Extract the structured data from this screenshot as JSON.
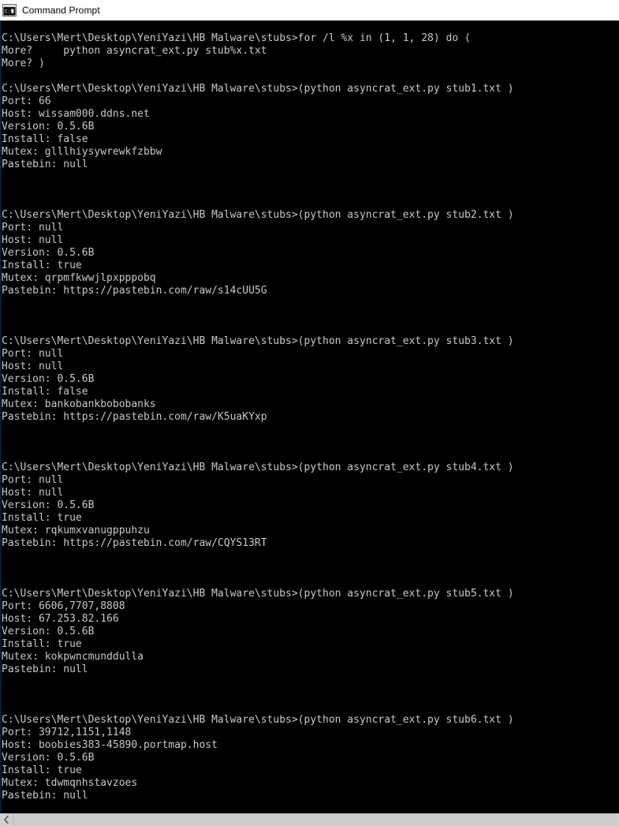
{
  "window": {
    "title": "Command Prompt",
    "icon": "console-icon",
    "colors": {
      "titlebar_bg": "#ffffff",
      "titlebar_text": "#000000",
      "console_bg": "#000000",
      "console_text": "#c8c8c8",
      "scrollbar_bg": "#d0d0d0"
    }
  },
  "scrollbar": {
    "left_arrow_icon": "chevron-left-icon",
    "orientation": "horizontal"
  },
  "console": {
    "prompt_path": "C:\\Users\\Mert\\Desktop\\YeniYazi\\HB Malware\\stubs>",
    "lines": [
      "C:\\Users\\Mert\\Desktop\\YeniYazi\\HB Malware\\stubs>for /l %x in (1, 1, 28) do (",
      "More?     python asyncrat_ext.py stub%x.txt",
      "More? )",
      "",
      "C:\\Users\\Mert\\Desktop\\YeniYazi\\HB Malware\\stubs>(python asyncrat_ext.py stub1.txt )",
      "Port: 66",
      "Host: wissam000.ddns.net",
      "Version: 0.5.6B",
      "Install: false",
      "Mutex: glllhiysywrewkfzbbw",
      "Pastebin: null",
      "",
      "",
      "",
      "C:\\Users\\Mert\\Desktop\\YeniYazi\\HB Malware\\stubs>(python asyncrat_ext.py stub2.txt )",
      "Port: null",
      "Host: null",
      "Version: 0.5.6B",
      "Install: true",
      "Mutex: qrpmfkwwjlpxpppobq",
      "Pastebin: https://pastebin.com/raw/s14cUU5G",
      "",
      "",
      "",
      "C:\\Users\\Mert\\Desktop\\YeniYazi\\HB Malware\\stubs>(python asyncrat_ext.py stub3.txt )",
      "Port: null",
      "Host: null",
      "Version: 0.5.6B",
      "Install: false",
      "Mutex: bankobankbobobanks",
      "Pastebin: https://pastebin.com/raw/K5uaKYxp",
      "",
      "",
      "",
      "C:\\Users\\Mert\\Desktop\\YeniYazi\\HB Malware\\stubs>(python asyncrat_ext.py stub4.txt )",
      "Port: null",
      "Host: null",
      "Version: 0.5.6B",
      "Install: true",
      "Mutex: rqkumxvanugppuhzu",
      "Pastebin: https://pastebin.com/raw/CQYS13RT",
      "",
      "",
      "",
      "C:\\Users\\Mert\\Desktop\\YeniYazi\\HB Malware\\stubs>(python asyncrat_ext.py stub5.txt )",
      "Port: 6606,7707,8808",
      "Host: 67.253.82.166",
      "Version: 0.5.6B",
      "Install: true",
      "Mutex: kokpwncmunddulla",
      "Pastebin: null",
      "",
      "",
      "",
      "C:\\Users\\Mert\\Desktop\\YeniYazi\\HB Malware\\stubs>(python asyncrat_ext.py stub6.txt )",
      "Port: 39712,1151,1148",
      "Host: boobies383-45890.portmap.host",
      "Version: 0.5.6B",
      "Install: true",
      "Mutex: tdwmqnhstavzoes",
      "Pastebin: null"
    ],
    "stubs": [
      {
        "name": "stub1.txt",
        "command": "(python asyncrat_ext.py stub1.txt )",
        "port": "66",
        "host": "wissam000.ddns.net",
        "version": "0.5.6B",
        "install": "false",
        "mutex": "glllhiysywrewkfzbbw",
        "pastebin": "null"
      },
      {
        "name": "stub2.txt",
        "command": "(python asyncrat_ext.py stub2.txt )",
        "port": "null",
        "host": "null",
        "version": "0.5.6B",
        "install": "true",
        "mutex": "qrpmfkwwjlpxpppobq",
        "pastebin": "https://pastebin.com/raw/s14cUU5G"
      },
      {
        "name": "stub3.txt",
        "command": "(python asyncrat_ext.py stub3.txt )",
        "port": "null",
        "host": "null",
        "version": "0.5.6B",
        "install": "false",
        "mutex": "bankobankbobobanks",
        "pastebin": "https://pastebin.com/raw/K5uaKYxp"
      },
      {
        "name": "stub4.txt",
        "command": "(python asyncrat_ext.py stub4.txt )",
        "port": "null",
        "host": "null",
        "version": "0.5.6B",
        "install": "true",
        "mutex": "rqkumxvanugppuhzu",
        "pastebin": "https://pastebin.com/raw/CQYS13RT"
      },
      {
        "name": "stub5.txt",
        "command": "(python asyncrat_ext.py stub5.txt )",
        "port": "6606,7707,8808",
        "host": "67.253.82.166",
        "version": "0.5.6B",
        "install": "true",
        "mutex": "kokpwncmunddulla",
        "pastebin": "null"
      },
      {
        "name": "stub6.txt",
        "command": "(python asyncrat_ext.py stub6.txt )",
        "port": "39712,1151,1148",
        "host": "boobies383-45890.portmap.host",
        "version": "0.5.6B",
        "install": "true",
        "mutex": "tdwmqnhstavzoes",
        "pastebin": "null"
      }
    ]
  }
}
